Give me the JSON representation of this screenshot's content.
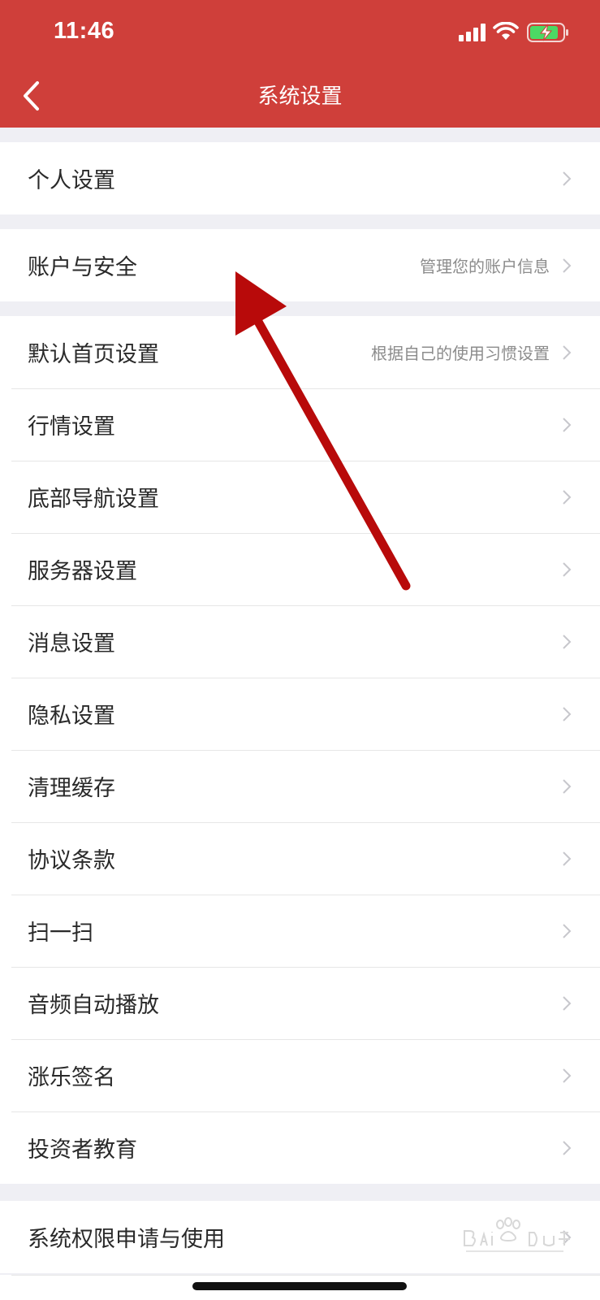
{
  "status_bar": {
    "time": "11:46"
  },
  "header": {
    "title": "系统设置"
  },
  "groups": [
    {
      "items": [
        {
          "label": "个人设置",
          "desc": ""
        }
      ]
    },
    {
      "items": [
        {
          "label": "账户与安全",
          "desc": "管理您的账户信息"
        }
      ]
    },
    {
      "items": [
        {
          "label": "默认首页设置",
          "desc": "根据自己的使用习惯设置"
        },
        {
          "label": "行情设置",
          "desc": ""
        },
        {
          "label": "底部导航设置",
          "desc": ""
        },
        {
          "label": "服务器设置",
          "desc": ""
        },
        {
          "label": "消息设置",
          "desc": ""
        },
        {
          "label": "隐私设置",
          "desc": ""
        },
        {
          "label": "清理缓存",
          "desc": ""
        },
        {
          "label": "协议条款",
          "desc": ""
        },
        {
          "label": "扫一扫",
          "desc": ""
        },
        {
          "label": "音频自动播放",
          "desc": ""
        },
        {
          "label": "涨乐签名",
          "desc": ""
        },
        {
          "label": "投资者教育",
          "desc": ""
        }
      ]
    },
    {
      "items": [
        {
          "label": "系统权限申请与使用",
          "desc": ""
        }
      ]
    }
  ],
  "colors": {
    "header_bg": "#cf3f3a",
    "page_bg": "#efeff4",
    "annotation_arrow": "#b80a0a"
  }
}
